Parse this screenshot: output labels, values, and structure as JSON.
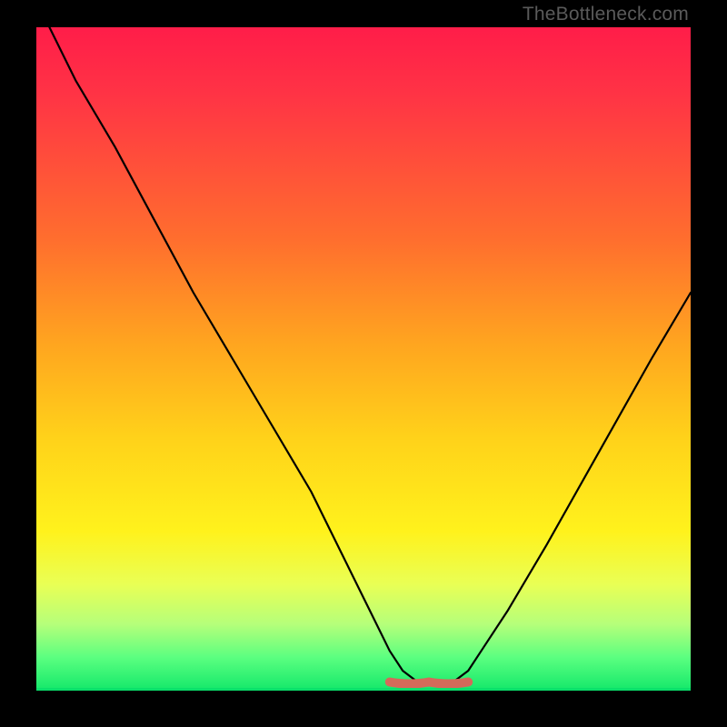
{
  "watermark": "TheBottleneck.com",
  "chart_data": {
    "type": "line",
    "title": "",
    "xlabel": "",
    "ylabel": "",
    "xlim": [
      0,
      100
    ],
    "ylim": [
      0,
      100
    ],
    "series": [
      {
        "name": "curve",
        "x": [
          2,
          6,
          12,
          18,
          24,
          30,
          36,
          42,
          47,
          51,
          54,
          56,
          58,
          60,
          62,
          64,
          66,
          68,
          72,
          78,
          86,
          94,
          100
        ],
        "values": [
          100,
          92,
          82,
          71,
          60,
          50,
          40,
          30,
          20,
          12,
          6,
          3,
          1.5,
          1,
          1,
          1.5,
          3,
          6,
          12,
          22,
          36,
          50,
          60
        ]
      }
    ],
    "trough_marker": {
      "x_start": 54,
      "x_end": 66,
      "y": 1.3,
      "color": "#d46a5a"
    },
    "gradient_stops": [
      {
        "pos": 0,
        "color": "#ff1d49"
      },
      {
        "pos": 32,
        "color": "#ff6e2e"
      },
      {
        "pos": 62,
        "color": "#ffd21a"
      },
      {
        "pos": 84,
        "color": "#e9ff55"
      },
      {
        "pos": 100,
        "color": "#13e86a"
      }
    ]
  }
}
